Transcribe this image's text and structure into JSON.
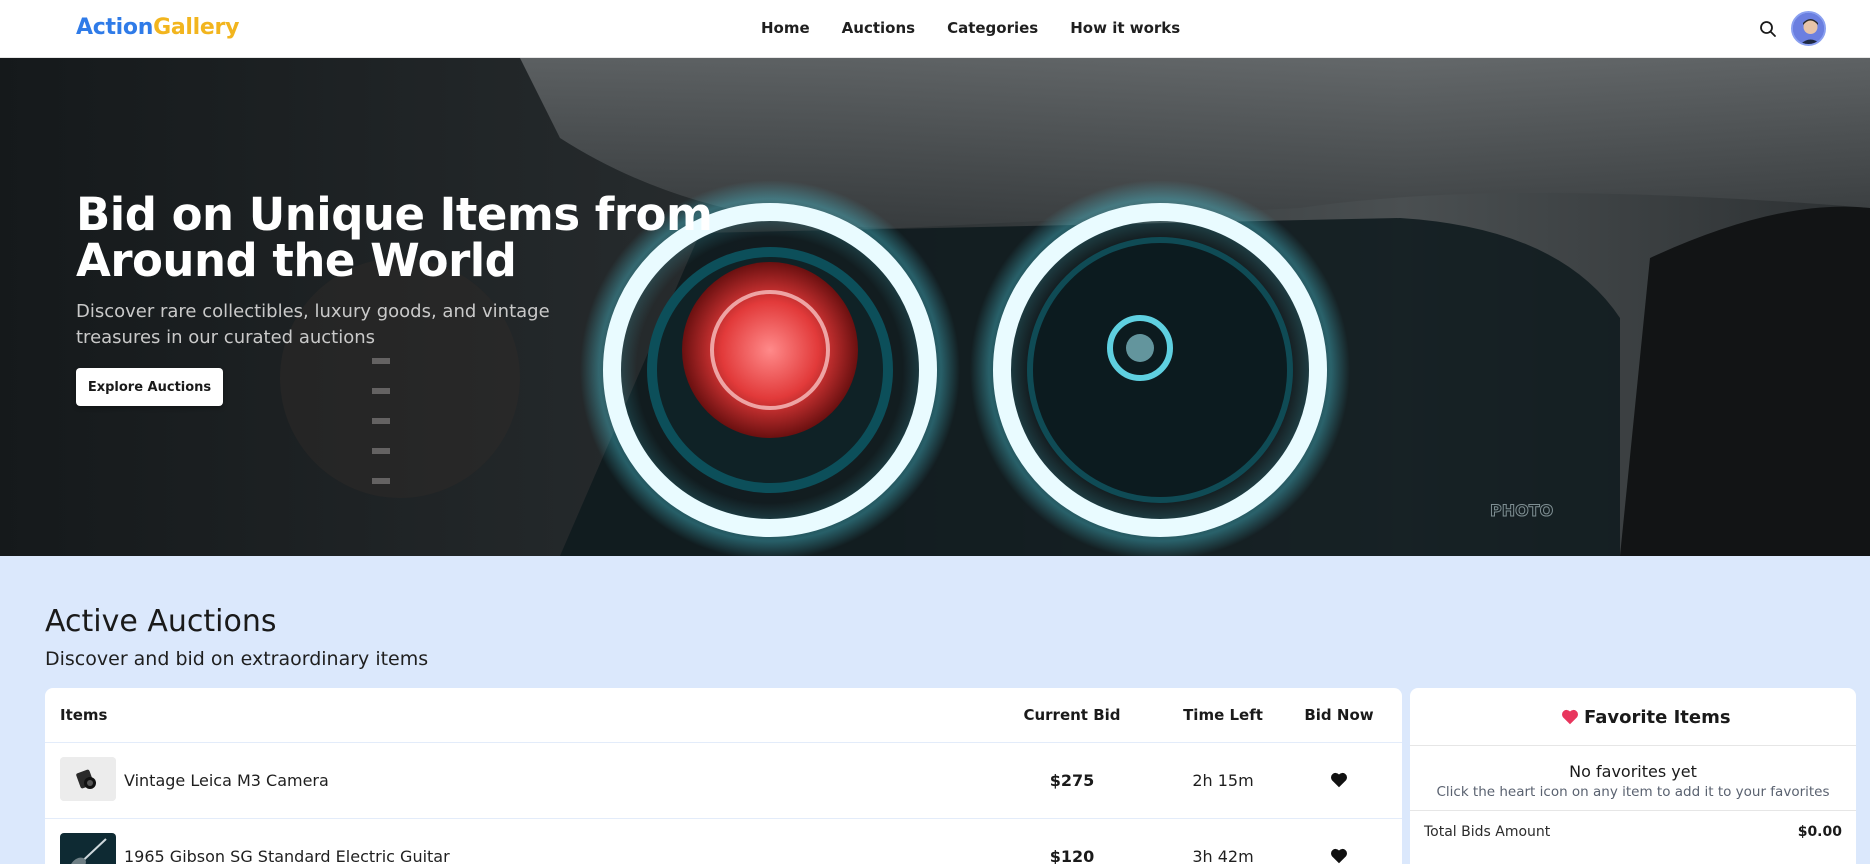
{
  "header": {
    "logo_part1": "Action",
    "logo_part2": "Gallery",
    "nav": [
      "Home",
      "Auctions",
      "Categories",
      "How it works"
    ],
    "search_icon": "search-icon",
    "avatar_icon": "user-avatar"
  },
  "hero": {
    "title": "Bid on Unique Items from Around the World",
    "subtitle": "Discover rare collectibles, luxury goods, and vintage treasures in our curated auctions",
    "button": "Explore Auctions",
    "watermark": "PHOTO"
  },
  "auctions": {
    "title": "Active Auctions",
    "subtitle": "Discover and bid on extraordinary items",
    "columns": {
      "items": "Items",
      "current_bid": "Current Bid",
      "time_left": "Time Left",
      "bid_now": "Bid Now"
    },
    "rows": [
      {
        "name": "Vintage Leica M3 Camera",
        "bid": "$275",
        "time": "2h 15m",
        "icon": "camera-thumb"
      },
      {
        "name": "1965 Gibson SG Standard Electric Guitar",
        "bid": "$120",
        "time": "3h 42m",
        "icon": "guitar-thumb"
      }
    ]
  },
  "favorites": {
    "title": "Favorite Items",
    "empty_title": "No favorites yet",
    "empty_hint": "Click the heart icon on any item to add it to your favorites",
    "total_label": "Total Bids Amount",
    "total_value": "$0.00"
  },
  "colors": {
    "logo_primary": "#2f7be8",
    "logo_accent": "#f2b51e",
    "page_bg": "#dbe8fc",
    "heart_pink": "#e8365d"
  }
}
